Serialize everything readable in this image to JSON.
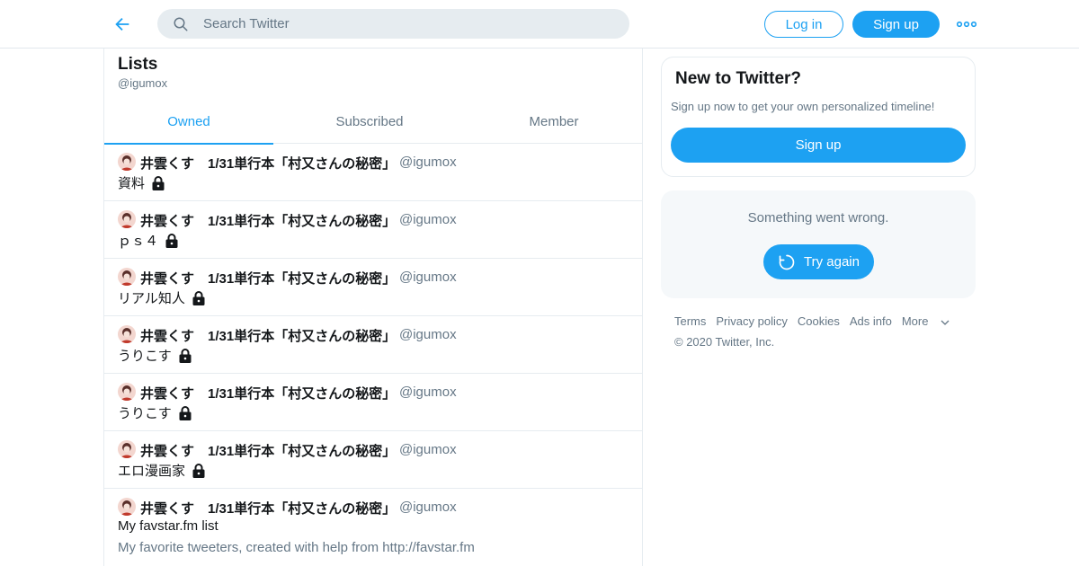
{
  "colors": {
    "accent": "#1da1f2",
    "text": "#14171a",
    "muted": "#657786",
    "border": "#e6ecf0",
    "search_bg": "#e6ecf0",
    "panel_bg": "#f5f8fa"
  },
  "header": {
    "back_icon": "arrow-left-icon",
    "search_placeholder": "Search Twitter",
    "search_icon": "search-icon",
    "login_label": "Log in",
    "signup_label": "Sign up",
    "more_icon": "more-dots-icon"
  },
  "page": {
    "title": "Lists",
    "handle": "@igumox"
  },
  "tabs": [
    {
      "label": "Owned",
      "active": true
    },
    {
      "label": "Subscribed",
      "active": false
    },
    {
      "label": "Member",
      "active": false
    }
  ],
  "lists": [
    {
      "owner": "井雲くす　1/31単行本「村又さんの秘密」",
      "handle": "@igumox",
      "name": "資料",
      "private": true
    },
    {
      "owner": "井雲くす　1/31単行本「村又さんの秘密」",
      "handle": "@igumox",
      "name": "ｐｓ４",
      "private": true
    },
    {
      "owner": "井雲くす　1/31単行本「村又さんの秘密」",
      "handle": "@igumox",
      "name": "リアル知人",
      "private": true
    },
    {
      "owner": "井雲くす　1/31単行本「村又さんの秘密」",
      "handle": "@igumox",
      "name": "うりこす",
      "private": true
    },
    {
      "owner": "井雲くす　1/31単行本「村又さんの秘密」",
      "handle": "@igumox",
      "name": "うりこす",
      "private": true
    },
    {
      "owner": "井雲くす　1/31単行本「村又さんの秘密」",
      "handle": "@igumox",
      "name": "エロ漫画家",
      "private": true
    },
    {
      "owner": "井雲くす　1/31単行本「村又さんの秘密」",
      "handle": "@igumox",
      "name": "My favstar.fm list",
      "private": false,
      "description": "My favorite tweeters, created with help from http://favstar.fm"
    }
  ],
  "sidebar": {
    "new_title": "New to Twitter?",
    "new_subtitle": "Sign up now to get your own personalized timeline!",
    "new_signup_label": "Sign up",
    "error_text": "Something went wrong.",
    "retry_label": "Try again",
    "retry_icon": "refresh-icon"
  },
  "footer": {
    "links": [
      "Terms",
      "Privacy policy",
      "Cookies",
      "Ads info"
    ],
    "more_label": "More",
    "copyright": "© 2020 Twitter, Inc."
  }
}
